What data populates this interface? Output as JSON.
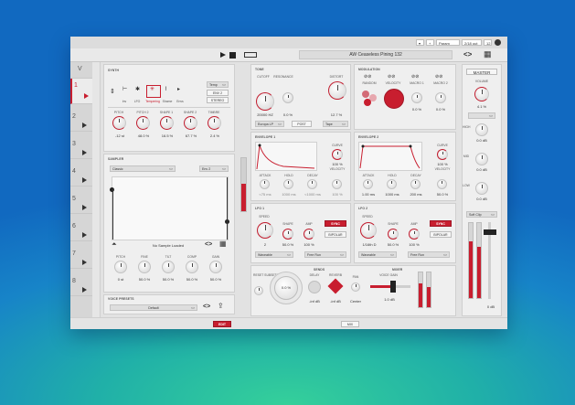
{
  "titlebar": {
    "param_label": "Param",
    "counter": "2/18 out",
    "small_value": "12"
  },
  "header": {
    "preset_name": "AW Ceaseless Pining 132",
    "master_label": "MASTER"
  },
  "tracks": [
    {
      "num": "V"
    },
    {
      "num": "1"
    },
    {
      "num": "2"
    },
    {
      "num": "3"
    },
    {
      "num": "4"
    },
    {
      "num": "5"
    },
    {
      "num": "6"
    },
    {
      "num": "7"
    },
    {
      "num": "8"
    }
  ],
  "synth": {
    "title": "SYNTH",
    "modes": [
      "Inv",
      "LFO",
      "Tempering",
      "Shame",
      "Envs"
    ],
    "options": [
      "Temp",
      "ENV 2",
      "STEREO"
    ],
    "knobs": [
      {
        "label": "PITCH",
        "value": "-12 st"
      },
      {
        "label": "PITCH 2",
        "value": "48.0 %"
      },
      {
        "label": "SHAPE 1",
        "value": "16.5 %"
      },
      {
        "label": "SHAPE 2",
        "value": "67.7 %"
      },
      {
        "label": "TIMBRE",
        "value": "2.4 %"
      }
    ]
  },
  "sampler": {
    "title": "SAMPLER",
    "preset": "Classic",
    "env": "Env 2",
    "status": "No Sample Loaded",
    "knobs": [
      {
        "label": "PITCH",
        "value": "0 st"
      },
      {
        "label": "FINE",
        "value": "50.0 %"
      },
      {
        "label": "TILT",
        "value": "50.0 %"
      },
      {
        "label": "COMP",
        "value": "50.0 %"
      },
      {
        "label": "GAIN",
        "value": "50.0 %"
      }
    ]
  },
  "voice_presets": {
    "title": "VOICE PRESETS",
    "value": "Default"
  },
  "tone": {
    "title": "TONE",
    "cutoff_label": "CUTOFF",
    "cutoff_value": "20000 HZ",
    "resonance_label": "RESONANCE",
    "resonance_value": "0.0 %",
    "distort_label": "DISTORT",
    "distort_value": "12.7 %",
    "filter_type": "Europa LP",
    "post_label": "POST",
    "tape_label": "Tape"
  },
  "modulation": {
    "title": "MODULATION",
    "labels": [
      "RANDOM",
      "VELOCITY",
      "MACRO 1",
      "MACRO 2"
    ],
    "macro_values": [
      "0.0 %",
      "0.0 %"
    ],
    "volume_label": "VOLUME",
    "volume_value": "4.1 %"
  },
  "envelope1": {
    "title": "ENVELOPE 1",
    "curve_label": "CURVE",
    "curve_value": "100 %",
    "velocity_label": "VELOCITY",
    "knob_labels": [
      "ATTACK",
      "HOLD",
      "DECAY"
    ],
    "knob_values": [
      "<75 ms",
      "1000 ms",
      "<1000 ms"
    ],
    "velocity_value": "100 %"
  },
  "envelope2": {
    "title": "ENVELOPE 2",
    "curve_label": "CURVE",
    "curve_value": "100 %",
    "velocity_label": "VELOCITY",
    "knob_labels": [
      "ATTACK",
      "HOLD",
      "DECAY"
    ],
    "knob_values": [
      "1.00 ms",
      "1000 ms",
      "200 ms"
    ],
    "velocity_value": "50.0 %"
  },
  "lfo1": {
    "title": "LFO 1",
    "speed_label": "SPEED",
    "speed_value": "2",
    "shape_label": "SHAPE",
    "shape_value": "50.0 %",
    "amp_label": "AMP",
    "amp_value": "100 %",
    "sync_label": "SYNC",
    "bipolar_label": "BIPOLAR",
    "waveform": "Waveable",
    "run": "Free Run"
  },
  "lfo2": {
    "title": "LFO 2",
    "speed_label": "SPEED",
    "speed_value": "1/16th D",
    "shape_label": "SHAPE",
    "shape_value": "50.0 %",
    "amp_label": "AMP",
    "amp_value": "100 %",
    "sync_label": "SYNC",
    "bipolar_label": "BIPOLAR",
    "waveform": "Waveable",
    "run": "Free Run"
  },
  "send": {
    "reset_label": "RESET SUBSETS",
    "pad_value": "0.0 %",
    "sends_title": "SENDS",
    "delay_label": "DELAY",
    "delay_value": "-inf dB",
    "reverb_label": "REVERB",
    "reverb_value": "-inf dB",
    "pan_label": "PAN",
    "pan_value": "Center",
    "mixer_title": "MIXER",
    "voice_gain_label": "VOICE GAIN",
    "voice_gain_value": "1.0 dB"
  },
  "master": {
    "labels": [
      "HIGH",
      "MID",
      "LOW"
    ],
    "values": [
      "0.0 dB",
      "0.0 dB",
      "0.0 dB"
    ],
    "soft_clip": "Soft Clip",
    "out_value": "0 dB"
  },
  "footer": {
    "left_btn": "EDIT",
    "right_btn": "MIX"
  }
}
